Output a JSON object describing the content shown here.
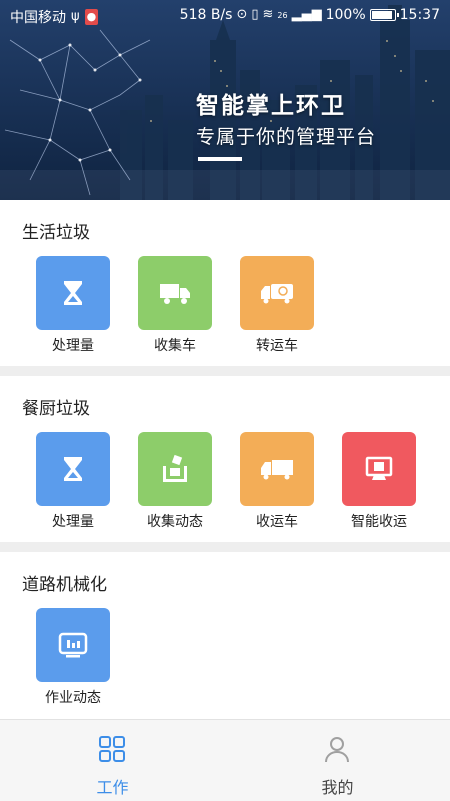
{
  "status_bar": {
    "carrier": "中国移动",
    "net_speed": "518 B/s",
    "signal_tag": "26",
    "battery": "100%",
    "time": "15:37"
  },
  "banner": {
    "title": "智能掌上环卫",
    "subtitle": "专属于你的管理平台"
  },
  "sections": {
    "domestic": {
      "title": "生活垃圾",
      "items": [
        {
          "label": "处理量",
          "icon": "hourglass-icon",
          "color": "#5b9cec"
        },
        {
          "label": "收集车",
          "icon": "truck-icon",
          "color": "#8dcd6a"
        },
        {
          "label": "转运车",
          "icon": "transfer-truck-icon",
          "color": "#f3ad57"
        }
      ]
    },
    "kitchen": {
      "title": "餐厨垃圾",
      "items": [
        {
          "label": "处理量",
          "icon": "hourglass-icon",
          "color": "#5b9cec"
        },
        {
          "label": "收集动态",
          "icon": "collection-box-icon",
          "color": "#8dcd6a"
        },
        {
          "label": "收运车",
          "icon": "truck-icon",
          "color": "#f3ad57"
        },
        {
          "label": "智能收运",
          "icon": "smart-monitor-icon",
          "color": "#f0595f"
        }
      ]
    },
    "road": {
      "title": "道路机械化",
      "items": [
        {
          "label": "作业动态",
          "icon": "dashboard-icon",
          "color": "#5b9cec"
        }
      ]
    }
  },
  "tabbar": {
    "active_color": "#3d8ee8",
    "tabs": [
      {
        "label": "工作",
        "icon": "grid-icon",
        "active": true
      },
      {
        "label": "我的",
        "icon": "person-icon",
        "active": false
      }
    ]
  }
}
